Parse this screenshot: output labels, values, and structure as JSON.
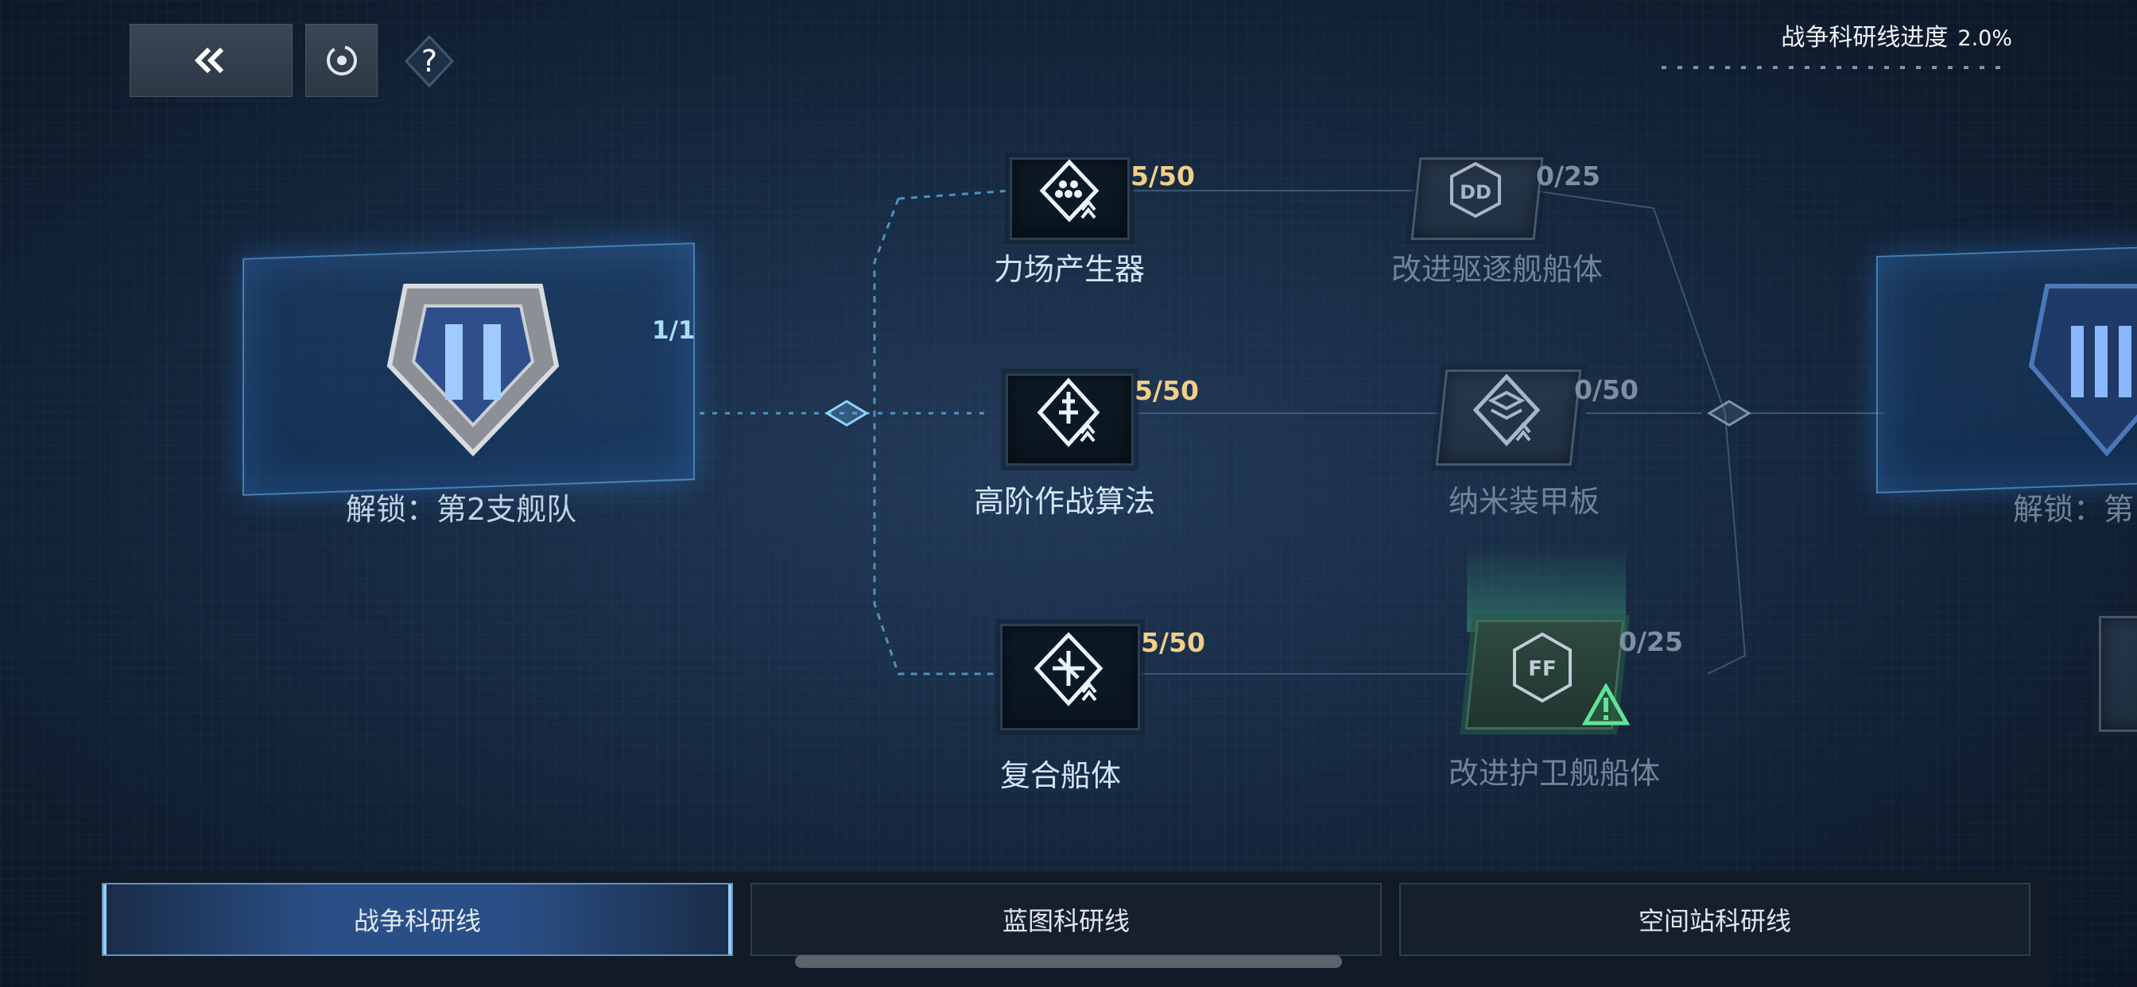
{
  "toolbar": {
    "back_icon": "double-chevron-left-icon",
    "record_icon": "circular-record-icon",
    "help_icon": "question-diamond-icon"
  },
  "progress": {
    "label": "战争科研线进度",
    "value": "2.0%"
  },
  "tiers": [
    {
      "count": "1/1",
      "label": "解锁：第2支舰队",
      "emblem": "rank-II-shield-icon"
    },
    {
      "label": "解锁：第",
      "emblem": "rank-III-shield-icon"
    }
  ],
  "nodes": {
    "force_field": {
      "count": "5/50",
      "label": "力场产生器",
      "icon": "force-field-generator-icon"
    },
    "advanced_algo": {
      "count": "5/50",
      "label": "高阶作战算法",
      "icon": "combat-algorithm-icon"
    },
    "composite_hull": {
      "count": "5/50",
      "label": "复合船体",
      "icon": "composite-hull-icon"
    },
    "destroyer_hull": {
      "count": "0/25",
      "label": "改进驱逐舰船体",
      "icon": "DD-hull-icon",
      "badge": "DD"
    },
    "nano_armor": {
      "count": "0/50",
      "label": "纳米装甲板",
      "icon": "nano-armor-icon"
    },
    "frigate_hull": {
      "count": "0/25",
      "label": "改进护卫舰船体",
      "icon": "FF-hull-icon",
      "badge": "FF",
      "warning_icon": "warning-triangle-icon"
    }
  },
  "tabs": [
    {
      "label": "战争科研线",
      "active": true
    },
    {
      "label": "蓝图科研线",
      "active": false
    },
    {
      "label": "空间站科研线",
      "active": false
    }
  ],
  "colors": {
    "accent": "#8fd0ff",
    "active_count": "#f0cf8a",
    "locked": "#71859a",
    "warning": "#5fe39a"
  }
}
